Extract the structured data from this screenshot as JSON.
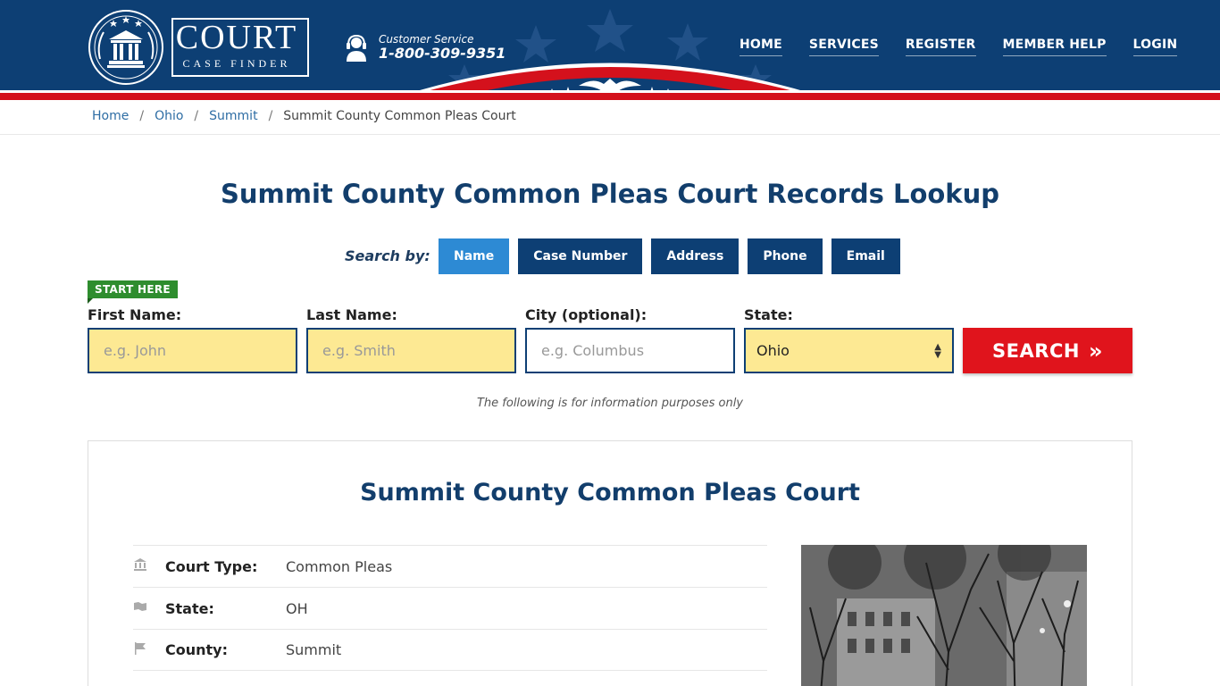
{
  "brand": {
    "logo_word": "COURT",
    "logo_sub": "CASE FINDER"
  },
  "customer_service": {
    "label": "Customer Service",
    "phone": "1-800-309-9351"
  },
  "nav": {
    "items": [
      {
        "label": "HOME"
      },
      {
        "label": "SERVICES"
      },
      {
        "label": "REGISTER"
      },
      {
        "label": "MEMBER HELP"
      },
      {
        "label": "LOGIN"
      }
    ]
  },
  "breadcrumb": {
    "items": [
      "Home",
      "Ohio",
      "Summit"
    ],
    "separator": "/",
    "current": "Summit County Common Pleas Court"
  },
  "page_title": "Summit County Common Pleas Court Records Lookup",
  "search": {
    "search_by_label": "Search by:",
    "tabs": [
      {
        "label": "Name",
        "active": true
      },
      {
        "label": "Case Number",
        "active": false
      },
      {
        "label": "Address",
        "active": false
      },
      {
        "label": "Phone",
        "active": false
      },
      {
        "label": "Email",
        "active": false
      }
    ],
    "start_here": "START HERE",
    "fields": {
      "first_name": {
        "label": "First Name:",
        "placeholder": "e.g. John",
        "value": ""
      },
      "last_name": {
        "label": "Last Name:",
        "placeholder": "e.g. Smith",
        "value": ""
      },
      "city": {
        "label": "City (optional):",
        "placeholder": "e.g.  Columbus",
        "value": ""
      },
      "state": {
        "label": "State:",
        "value": "Ohio"
      }
    },
    "button_label": "SEARCH",
    "button_icon": "double-chevron-right-icon",
    "note": "The following is for information purposes only"
  },
  "court": {
    "title": "Summit County Common Pleas Court",
    "details": [
      {
        "icon": "courthouse-icon",
        "key": "Court Type:",
        "value": "Common Pleas"
      },
      {
        "icon": "map-icon",
        "key": "State:",
        "value": "OH"
      },
      {
        "icon": "flag-icon",
        "key": "County:",
        "value": "Summit"
      }
    ]
  },
  "colors": {
    "header_blue": "#0d3f74",
    "accent_red": "#e0141c",
    "tab_active": "#2d8ad4",
    "field_yellow": "#fde993",
    "start_green": "#2e8d2e"
  }
}
